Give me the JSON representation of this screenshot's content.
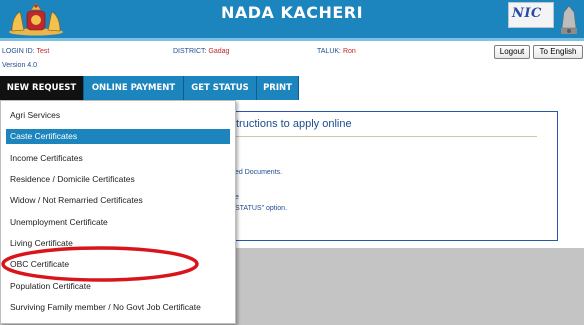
{
  "header": {
    "title": "NADA KACHERI",
    "right_logo_text": "NIC",
    "brand_color": "#1d85bd"
  },
  "info": {
    "login_label": "LOGIN ID:",
    "login_value": "Test",
    "district_label": "DISTRICT:",
    "district_value": "Gadag",
    "taluk_label": "TALUK:",
    "taluk_value": "Ron",
    "version": "Version 4.0"
  },
  "buttons": {
    "logout": "Logout",
    "english": "To English"
  },
  "nav": {
    "items": [
      {
        "label": "NEW REQUEST"
      },
      {
        "label": "ONLINE PAYMENT"
      },
      {
        "label": "GET STATUS"
      },
      {
        "label": "PRINT"
      }
    ]
  },
  "dropdown": {
    "items": [
      {
        "label": "Agri Services"
      },
      {
        "label": "Caste Certificates"
      },
      {
        "label": "Income Certificates"
      },
      {
        "label": "Residence / Domicile Certificates"
      },
      {
        "label": "Widow / Not Remarried Certificates"
      },
      {
        "label": "Unemployment Certificate"
      },
      {
        "label": "Living Certificate"
      },
      {
        "label": "OBC Certificate"
      },
      {
        "label": "Population Certificate"
      },
      {
        "label": "Surviving Family member / No Govt Job Certificate"
      }
    ],
    "highlight_color": "#1d85bd"
  },
  "panel": {
    "title_fragment": "tructions to apply online",
    "text1": "ed Documents.",
    "text2": "e",
    "text3": " STATUS\" option."
  },
  "annotation": {
    "ellipse_color": "#d9141b"
  }
}
